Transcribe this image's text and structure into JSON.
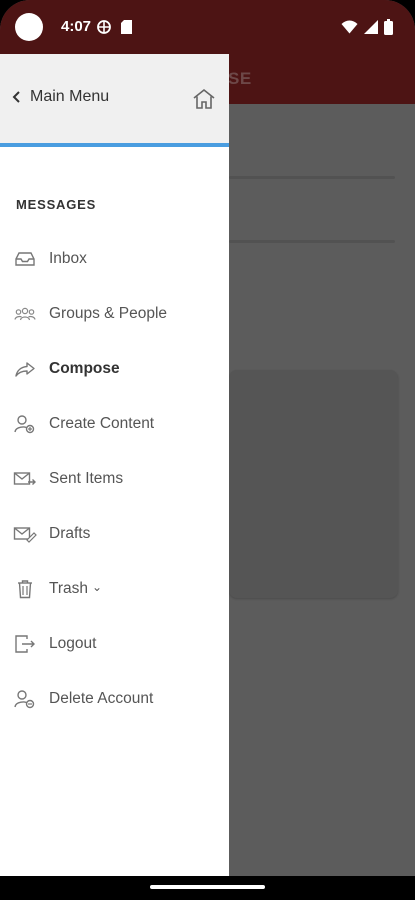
{
  "status_bar": {
    "time": "4:07"
  },
  "background_app": {
    "title_fragment": "SE"
  },
  "drawer": {
    "back_label": "Main Menu",
    "section_title": "MESSAGES",
    "items": [
      {
        "label": "Inbox",
        "icon": "inbox-icon"
      },
      {
        "label": "Groups & People",
        "icon": "groups-icon"
      },
      {
        "label": "Compose",
        "icon": "compose-icon",
        "active": true
      },
      {
        "label": "Create Content",
        "icon": "create-content-icon"
      },
      {
        "label": "Sent Items",
        "icon": "sent-items-icon"
      },
      {
        "label": "Drafts",
        "icon": "drafts-icon"
      },
      {
        "label": "Trash",
        "icon": "trash-icon",
        "chevron": "⌄"
      },
      {
        "label": "Logout",
        "icon": "logout-icon"
      },
      {
        "label": "Delete Account",
        "icon": "delete-account-icon"
      }
    ]
  },
  "colors": {
    "brand": "#4d1414",
    "accent": "#4a9de0",
    "scrim": "#5c5c5c"
  }
}
